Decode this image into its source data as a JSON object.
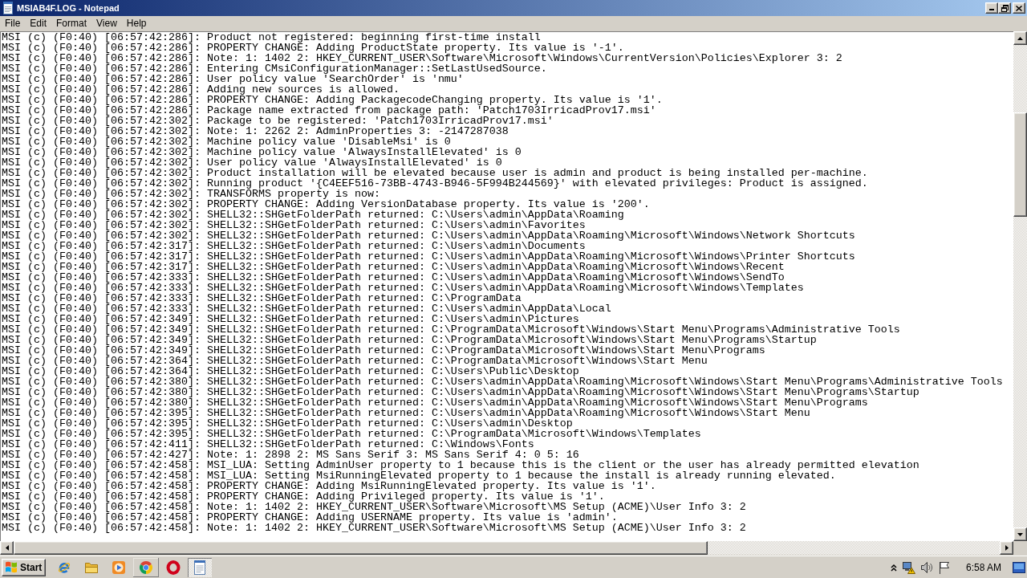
{
  "window": {
    "title": "MSIAB4F.LOG - Notepad"
  },
  "menu": [
    "File",
    "Edit",
    "Format",
    "View",
    "Help"
  ],
  "lines": [
    "MSI (c) (F0:40) [06:57:42:286]: Product not registered: beginning first-time install",
    "MSI (c) (F0:40) [06:57:42:286]: PROPERTY CHANGE: Adding ProductState property. Its value is '-1'.",
    "MSI (c) (F0:40) [06:57:42:286]: Note: 1: 1402 2: HKEY_CURRENT_USER\\Software\\Microsoft\\Windows\\CurrentVersion\\Policies\\Explorer 3: 2",
    "MSI (c) (F0:40) [06:57:42:286]: Entering CMsiConfigurationManager::SetLastUsedSource.",
    "MSI (c) (F0:40) [06:57:42:286]: User policy value 'SearchOrder' is 'nmu'",
    "MSI (c) (F0:40) [06:57:42:286]: Adding new sources is allowed.",
    "MSI (c) (F0:40) [06:57:42:286]: PROPERTY CHANGE: Adding PackagecodeChanging property. Its value is '1'.",
    "MSI (c) (F0:40) [06:57:42:286]: Package name extracted from package path: 'Patch1703IrricadProv17.msi'",
    "MSI (c) (F0:40) [06:57:42:302]: Package to be registered: 'Patch1703IrricadProv17.msi'",
    "MSI (c) (F0:40) [06:57:42:302]: Note: 1: 2262 2: AdminProperties 3: -2147287038",
    "MSI (c) (F0:40) [06:57:42:302]: Machine policy value 'DisableMsi' is 0",
    "MSI (c) (F0:40) [06:57:42:302]: Machine policy value 'AlwaysInstallElevated' is 0",
    "MSI (c) (F0:40) [06:57:42:302]: User policy value 'AlwaysInstallElevated' is 0",
    "MSI (c) (F0:40) [06:57:42:302]: Product installation will be elevated because user is admin and product is being installed per-machine.",
    "MSI (c) (F0:40) [06:57:42:302]: Running product '{C4EEF516-73BB-4743-B946-5F994B244569}' with elevated privileges: Product is assigned.",
    "MSI (c) (F0:40) [06:57:42:302]: TRANSFORMS property is now:",
    "MSI (c) (F0:40) [06:57:42:302]: PROPERTY CHANGE: Adding VersionDatabase property. Its value is '200'.",
    "MSI (c) (F0:40) [06:57:42:302]: SHELL32::SHGetFolderPath returned: C:\\Users\\admin\\AppData\\Roaming",
    "MSI (c) (F0:40) [06:57:42:302]: SHELL32::SHGetFolderPath returned: C:\\Users\\admin\\Favorites",
    "MSI (c) (F0:40) [06:57:42:302]: SHELL32::SHGetFolderPath returned: C:\\Users\\admin\\AppData\\Roaming\\Microsoft\\Windows\\Network Shortcuts",
    "MSI (c) (F0:40) [06:57:42:317]: SHELL32::SHGetFolderPath returned: C:\\Users\\admin\\Documents",
    "MSI (c) (F0:40) [06:57:42:317]: SHELL32::SHGetFolderPath returned: C:\\Users\\admin\\AppData\\Roaming\\Microsoft\\Windows\\Printer Shortcuts",
    "MSI (c) (F0:40) [06:57:42:317]: SHELL32::SHGetFolderPath returned: C:\\Users\\admin\\AppData\\Roaming\\Microsoft\\Windows\\Recent",
    "MSI (c) (F0:40) [06:57:42:333]: SHELL32::SHGetFolderPath returned: C:\\Users\\admin\\AppData\\Roaming\\Microsoft\\Windows\\SendTo",
    "MSI (c) (F0:40) [06:57:42:333]: SHELL32::SHGetFolderPath returned: C:\\Users\\admin\\AppData\\Roaming\\Microsoft\\Windows\\Templates",
    "MSI (c) (F0:40) [06:57:42:333]: SHELL32::SHGetFolderPath returned: C:\\ProgramData",
    "MSI (c) (F0:40) [06:57:42:333]: SHELL32::SHGetFolderPath returned: C:\\Users\\admin\\AppData\\Local",
    "MSI (c) (F0:40) [06:57:42:349]: SHELL32::SHGetFolderPath returned: C:\\Users\\admin\\Pictures",
    "MSI (c) (F0:40) [06:57:42:349]: SHELL32::SHGetFolderPath returned: C:\\ProgramData\\Microsoft\\Windows\\Start Menu\\Programs\\Administrative Tools",
    "MSI (c) (F0:40) [06:57:42:349]: SHELL32::SHGetFolderPath returned: C:\\ProgramData\\Microsoft\\Windows\\Start Menu\\Programs\\Startup",
    "MSI (c) (F0:40) [06:57:42:349]: SHELL32::SHGetFolderPath returned: C:\\ProgramData\\Microsoft\\Windows\\Start Menu\\Programs",
    "MSI (c) (F0:40) [06:57:42:364]: SHELL32::SHGetFolderPath returned: C:\\ProgramData\\Microsoft\\Windows\\Start Menu",
    "MSI (c) (F0:40) [06:57:42:364]: SHELL32::SHGetFolderPath returned: C:\\Users\\Public\\Desktop",
    "MSI (c) (F0:40) [06:57:42:380]: SHELL32::SHGetFolderPath returned: C:\\Users\\admin\\AppData\\Roaming\\Microsoft\\Windows\\Start Menu\\Programs\\Administrative Tools",
    "MSI (c) (F0:40) [06:57:42:380]: SHELL32::SHGetFolderPath returned: C:\\Users\\admin\\AppData\\Roaming\\Microsoft\\Windows\\Start Menu\\Programs\\Startup",
    "MSI (c) (F0:40) [06:57:42:380]: SHELL32::SHGetFolderPath returned: C:\\Users\\admin\\AppData\\Roaming\\Microsoft\\Windows\\Start Menu\\Programs",
    "MSI (c) (F0:40) [06:57:42:395]: SHELL32::SHGetFolderPath returned: C:\\Users\\admin\\AppData\\Roaming\\Microsoft\\Windows\\Start Menu",
    "MSI (c) (F0:40) [06:57:42:395]: SHELL32::SHGetFolderPath returned: C:\\Users\\admin\\Desktop",
    "MSI (c) (F0:40) [06:57:42:395]: SHELL32::SHGetFolderPath returned: C:\\ProgramData\\Microsoft\\Windows\\Templates",
    "MSI (c) (F0:40) [06:57:42:411]: SHELL32::SHGetFolderPath returned: C:\\Windows\\Fonts",
    "MSI (c) (F0:40) [06:57:42:427]: Note: 1: 2898 2: MS Sans Serif 3: MS Sans Serif 4: 0 5: 16",
    "MSI (c) (F0:40) [06:57:42:458]: MSI_LUA: Setting AdminUser property to 1 because this is the client or the user has already permitted elevation",
    "MSI (c) (F0:40) [06:57:42:458]: MSI_LUA: Setting MsiRunningElevated property to 1 because the install is already running elevated.",
    "MSI (c) (F0:40) [06:57:42:458]: PROPERTY CHANGE: Adding MsiRunningElevated property. Its value is '1'.",
    "MSI (c) (F0:40) [06:57:42:458]: PROPERTY CHANGE: Adding Privileged property. Its value is '1'.",
    "MSI (c) (F0:40) [06:57:42:458]: Note: 1: 1402 2: HKEY_CURRENT_USER\\Software\\Microsoft\\MS Setup (ACME)\\User Info 3: 2",
    "MSI (c) (F0:40) [06:57:42:458]: PROPERTY CHANGE: Adding USERNAME property. Its value is 'admin'.",
    "MSI (c) (F0:40) [06:57:42:458]: Note: 1: 1402 2: HKEY_CURRENT_USER\\Software\\Microsoft\\MS Setup (ACME)\\User Info 3: 2"
  ],
  "taskbar": {
    "start": "Start",
    "apps": [
      {
        "kind": "browser",
        "running": false,
        "selected": false
      },
      {
        "kind": "folder",
        "running": false,
        "selected": false
      },
      {
        "kind": "player",
        "running": false,
        "selected": false
      },
      {
        "kind": "wheel",
        "running": true,
        "selected": false
      },
      {
        "kind": "ring",
        "running": false,
        "selected": false
      },
      {
        "kind": "notepad",
        "running": true,
        "selected": true
      }
    ],
    "clock": "6:58 AM"
  }
}
